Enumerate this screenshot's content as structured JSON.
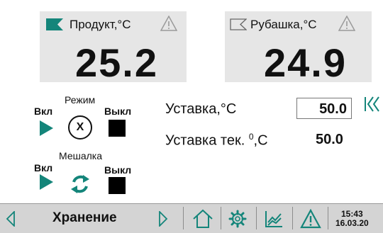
{
  "panels": {
    "product": {
      "label": "Продукт,°С",
      "value": "25.2",
      "flag_color": "#14857a",
      "flag_icon": "flag-filled-icon",
      "warn_icon": "warning-outline-icon"
    },
    "jacket": {
      "label": "Рубашка,°С",
      "value": "24.9",
      "flag_icon": "flag-outline-icon",
      "warn_icon": "warning-outline-icon"
    }
  },
  "mode": {
    "title": "Режим",
    "on_label": "Вкл",
    "off_label": "Выкл",
    "status_symbol": "X"
  },
  "mixer": {
    "title": "Мешалка",
    "on_label": "Вкл",
    "off_label": "Выкл"
  },
  "setpoint": {
    "label": "Уставка,°С",
    "value": "50.0"
  },
  "current_setpoint": {
    "label_prefix": "Уставка тек. ",
    "label_sup": "0",
    "label_suffix": ",С",
    "value": "50.0"
  },
  "bottom_bar": {
    "mode_label": "Хранение",
    "time": "15:43",
    "date": "16.03.20"
  },
  "colors": {
    "accent": "#14857a",
    "background": "#d4d4d4",
    "panel": "#e6e6e6"
  }
}
